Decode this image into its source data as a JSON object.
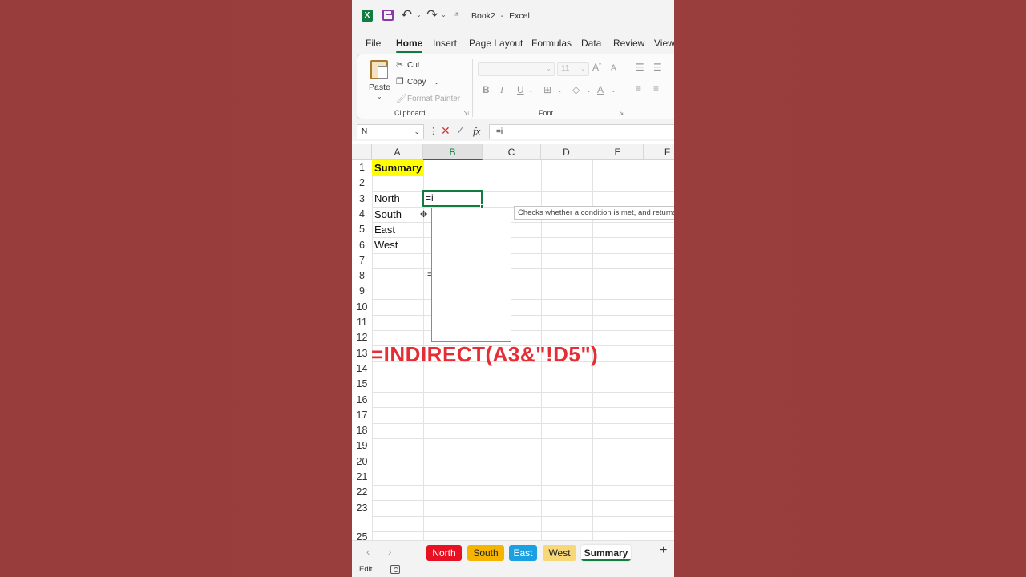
{
  "titlebar": {
    "app_logo": "X",
    "doc_title": "Book2",
    "separator": "-",
    "app_name": "Excel",
    "qat_more": "⩡"
  },
  "menu_tabs": [
    "File",
    "Home",
    "Insert",
    "Page Layout",
    "Formulas",
    "Data",
    "Review",
    "View"
  ],
  "active_menu_tab": "Home",
  "ribbon": {
    "clipboard": {
      "paste": "Paste",
      "cut": "Cut",
      "copy": "Copy",
      "format_painter": "Format Painter",
      "group_label": "Clipboard"
    },
    "font": {
      "font_name": "",
      "font_size": "11",
      "grow": "A",
      "shrink": "A",
      "bold": "B",
      "italic": "I",
      "underline": "U",
      "font_color": "A",
      "group_label": "Font"
    }
  },
  "formula_bar": {
    "name_box": "N",
    "formula": "=i"
  },
  "grid": {
    "columns": [
      "A",
      "B",
      "C",
      "D",
      "E",
      "F"
    ],
    "selected_column": "B",
    "rows": [
      "1",
      "2",
      "3",
      "4",
      "5",
      "6",
      "7",
      "8",
      "9",
      "10",
      "11",
      "12",
      "13",
      "14",
      "15",
      "16",
      "17",
      "18",
      "19",
      "20",
      "21",
      "22",
      "23",
      "25"
    ],
    "cells": {
      "A1": "Summary",
      "A3": "North",
      "A4": "South",
      "A5": "East",
      "A6": "West"
    },
    "active_cell_value": "=i",
    "stray_char": "=",
    "tooltip": "Checks whether a condition is met, and returns one value if TRUE",
    "overlay_formula": "=INDIRECT(A3&\"!D5\")"
  },
  "sheet_tabs": [
    {
      "name": "North",
      "color": "#e81123"
    },
    {
      "name": "South",
      "color": "#f4b400"
    },
    {
      "name": "East",
      "color": "#1ba1e2"
    },
    {
      "name": "West",
      "color": "#f8d778"
    },
    {
      "name": "Summary",
      "color": "#ffffff"
    }
  ],
  "active_sheet": "Summary",
  "add_sheet": "+",
  "status": {
    "mode": "Edit"
  },
  "colors": {
    "accent": "#107c41",
    "overlay_text": "#e42d35",
    "summary_highlight": "#ffff00",
    "background": "#983c3c"
  }
}
